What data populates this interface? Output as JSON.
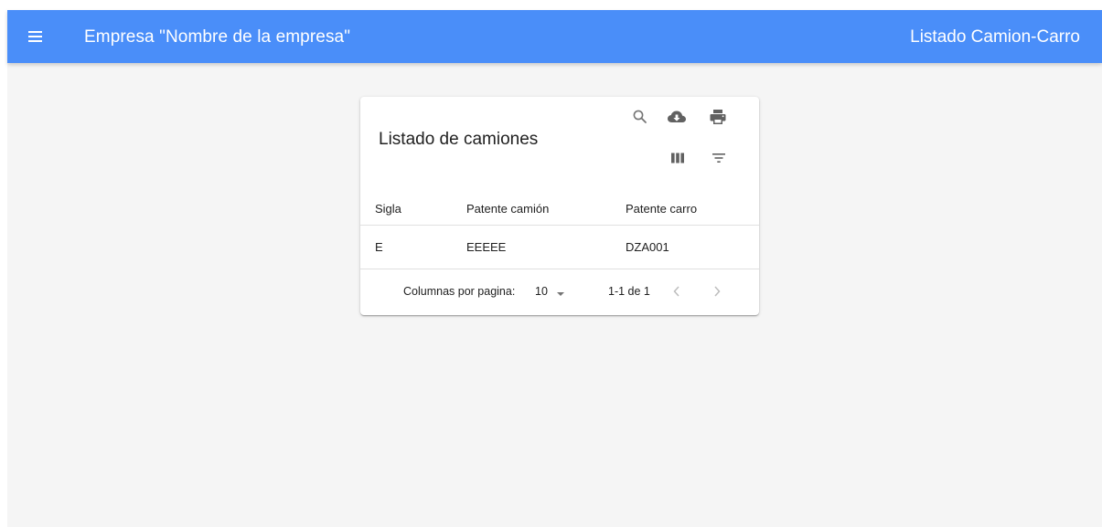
{
  "appbar": {
    "menu_icon": "hamburger-menu-icon",
    "app_title": "Empresa \"Nombre de la empresa\"",
    "page_title": "Listado Camion-Carro",
    "color": "#4a8ef9"
  },
  "table": {
    "title": "Listado de camiones",
    "toolbar_icons": [
      "search-icon",
      "cloud-download-icon",
      "print-icon",
      "view-columns-icon",
      "filter-list-icon"
    ],
    "columns": [
      "Sigla",
      "Patente camión",
      "Patente carro"
    ],
    "rows": [
      [
        "E",
        "EEEEE",
        "DZA001"
      ]
    ],
    "pagination": {
      "rows_per_page_label": "Columnas por pagina:",
      "rows_per_page": "10",
      "range": "1-1 de 1"
    }
  }
}
